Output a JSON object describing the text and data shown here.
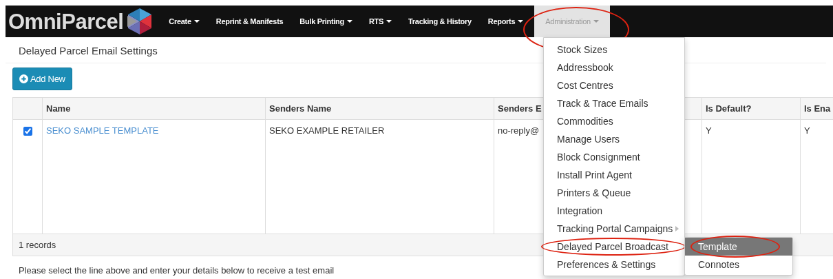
{
  "brand": {
    "name": "OmniParcel"
  },
  "nav": [
    {
      "label": "Create",
      "has_caret": true,
      "open": false,
      "circled": false
    },
    {
      "label": "Reprint & Manifests",
      "has_caret": false,
      "open": false,
      "circled": false
    },
    {
      "label": "Bulk Printing",
      "has_caret": true,
      "open": false,
      "circled": false
    },
    {
      "label": "RTS",
      "has_caret": true,
      "open": false,
      "circled": false
    },
    {
      "label": "Tracking & History",
      "has_caret": false,
      "open": false,
      "circled": false
    },
    {
      "label": "Reports",
      "has_caret": true,
      "open": false,
      "circled": false
    },
    {
      "label": "Administration",
      "has_caret": true,
      "open": true,
      "circled": true
    }
  ],
  "page_title": "Delayed Parcel Email Settings",
  "add_button": "Add New",
  "table": {
    "columns": [
      "Name",
      "Senders Name",
      "Senders E",
      "Is Default?",
      "Is Ena"
    ],
    "rows": [
      {
        "checked": true,
        "cells": [
          "SEKO SAMPLE TEMPLATE",
          "SEKO EXAMPLE RETAILER",
          "no-reply@",
          "Y",
          "Y"
        ]
      }
    ],
    "footer": "1 records"
  },
  "note": "Please select the line above and enter your details below to receive a test email",
  "dropdown": {
    "items": [
      {
        "label": "Stock Sizes",
        "has_submenu": false,
        "circled": false
      },
      {
        "label": "Addressbook",
        "has_submenu": false,
        "circled": false
      },
      {
        "label": "Cost Centres",
        "has_submenu": false,
        "circled": false
      },
      {
        "label": "Track & Trace Emails",
        "has_submenu": false,
        "circled": false
      },
      {
        "label": "Commodities",
        "has_submenu": false,
        "circled": false
      },
      {
        "label": "Manage Users",
        "has_submenu": false,
        "circled": false
      },
      {
        "label": "Block Consignment",
        "has_submenu": false,
        "circled": false
      },
      {
        "label": "Install Print Agent",
        "has_submenu": false,
        "circled": false
      },
      {
        "label": "Printers & Queue",
        "has_submenu": false,
        "circled": false
      },
      {
        "label": "Integration",
        "has_submenu": false,
        "circled": false
      },
      {
        "label": "Tracking Portal Campaigns",
        "has_submenu": true,
        "circled": false
      },
      {
        "label": "Delayed Parcel Broadcast",
        "has_submenu": false,
        "circled": true,
        "children": [
          {
            "label": "Template",
            "selected": true,
            "circled": true
          },
          {
            "label": "Connotes",
            "selected": false,
            "circled": false
          }
        ]
      },
      {
        "label": "Preferences & Settings",
        "has_submenu": false,
        "circled": false
      }
    ]
  }
}
